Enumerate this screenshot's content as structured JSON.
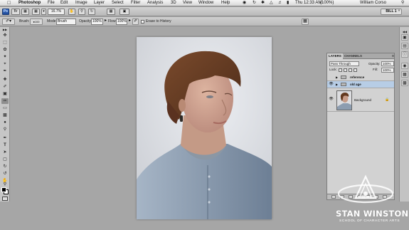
{
  "menubar": {
    "app_name": "Photoshop",
    "items": [
      "File",
      "Edit",
      "Image",
      "Layer",
      "Select",
      "Filter",
      "Analysis",
      "3D",
      "View",
      "Window",
      "Help"
    ],
    "battery": "(100%)",
    "clock": "Thu 12:33 AM",
    "user": "William Corso",
    "apple_icon": "apple-icon"
  },
  "appbar": {
    "app_badge": "Ps",
    "zoom": "16.7%",
    "workspace": "BILL 1"
  },
  "options": {
    "brush_label": "Brush:",
    "brush_size": "100",
    "mode_label": "Mode:",
    "mode_value": "Brush",
    "opacity_label": "Opacity:",
    "opacity_value": "100%",
    "flow_label": "Flow:",
    "flow_value": "100%",
    "erase_history_label": "Erase to History"
  },
  "tools": [
    "move",
    "marquee",
    "lasso",
    "quick-select",
    "crop",
    "eyedropper",
    "healing",
    "brush",
    "clone-stamp",
    "history-brush",
    "eraser",
    "gradient",
    "blur",
    "dodge",
    "pen",
    "type",
    "path-select",
    "shape",
    "3d-rotate",
    "3d-orbit",
    "hand",
    "zoom"
  ],
  "layers_panel": {
    "tab_layers": "LAYERS",
    "tab_channels": "CHANNELS",
    "blend_mode": "Pass Through",
    "opacity_label": "Opacity:",
    "opacity_value": "100%",
    "lock_label": "Lock:",
    "fill_label": "Fill:",
    "fill_value": "100%",
    "layers": [
      {
        "name": "reference",
        "type": "group",
        "visible": false,
        "selected": false
      },
      {
        "name": "old age",
        "type": "group",
        "visible": true,
        "selected": true
      },
      {
        "name": "Background",
        "type": "image",
        "visible": true,
        "selected": false
      }
    ],
    "selected_color": "#b7cde6"
  },
  "watermark": {
    "name": "STAN WINSTON",
    "subtitle": "SCHOOL OF CHARACTER ARTS"
  }
}
